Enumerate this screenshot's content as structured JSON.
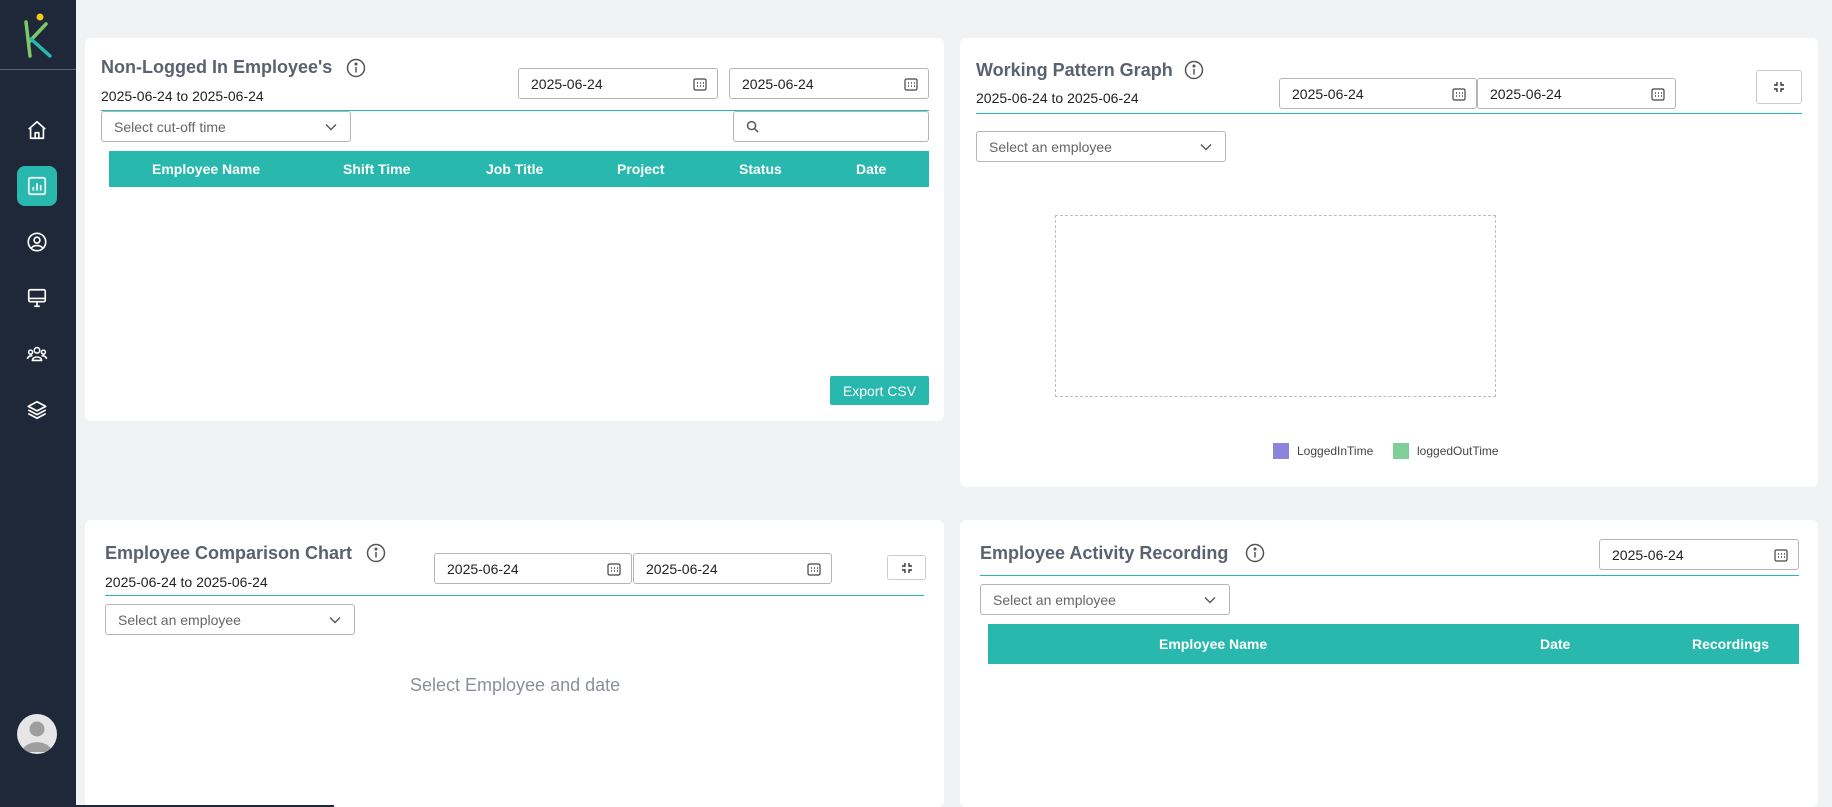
{
  "sidebar": {
    "logo_letter": "K",
    "items": [
      {
        "icon": "home-icon",
        "active": false
      },
      {
        "icon": "chart-icon",
        "active": true
      },
      {
        "icon": "user-icon",
        "active": false
      },
      {
        "icon": "monitor-icon",
        "active": false
      },
      {
        "icon": "users-icon",
        "active": false
      },
      {
        "icon": "layers-icon",
        "active": false
      }
    ],
    "accent": "#28b8ad"
  },
  "non_logged": {
    "title": "Non-Logged In Employee's",
    "range": "2025-06-24 to 2025-06-24",
    "from_date": "2025-06-24",
    "to_date": "2025-06-24",
    "cutoff_placeholder": "Select cut-off time",
    "search_placeholder": "",
    "columns": [
      "Employee Name",
      "Shift Time",
      "Job Title",
      "Project",
      "Status",
      "Date"
    ],
    "rows": [],
    "export_label": "Export CSV"
  },
  "working_pattern": {
    "title": "Working Pattern Graph",
    "range": "2025-06-24 to 2025-06-24",
    "from_date": "2025-06-24",
    "to_date": "2025-06-24",
    "employee_placeholder": "Select an employee",
    "legend": [
      {
        "label": "LoggedInTime",
        "color": "#8c85db"
      },
      {
        "label": "loggedOutTime",
        "color": "#7fcf9b"
      }
    ]
  },
  "comparison": {
    "title": "Employee Comparison Chart",
    "range": "2025-06-24 to 2025-06-24",
    "from_date": "2025-06-24",
    "to_date": "2025-06-24",
    "employee_placeholder": "Select an employee",
    "empty_message": "Select Employee and date"
  },
  "activity": {
    "title": "Employee Activity Recording",
    "date": "2025-06-24",
    "employee_placeholder": "Select an employee",
    "columns": [
      "Employee Name",
      "Date",
      "Recordings"
    ],
    "rows": []
  }
}
